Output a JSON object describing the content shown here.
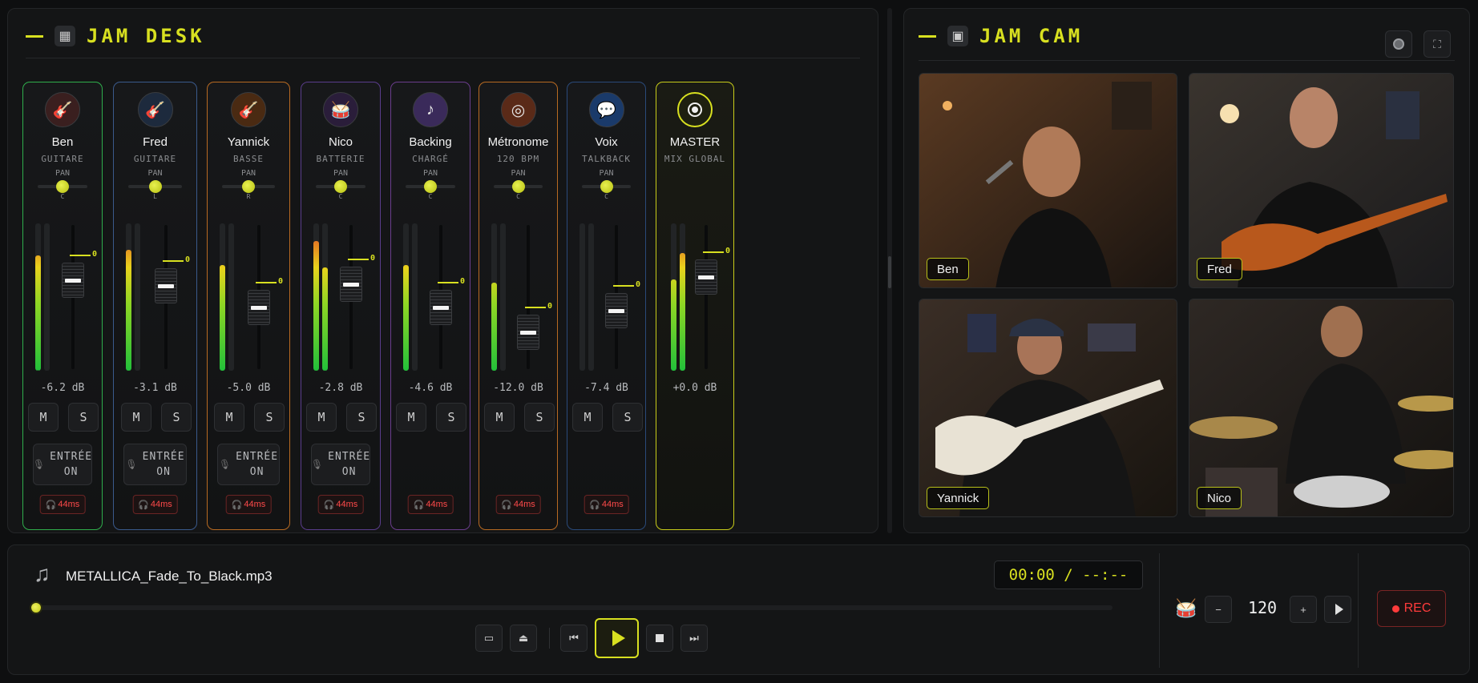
{
  "desk": {
    "title": "JAM DESK",
    "channels": [
      {
        "name": "Ben",
        "role": "GUITARE",
        "pan_label": "PAN",
        "pan_value": "C",
        "pan": 0.5,
        "db": "-6.2 dB",
        "mute": "M",
        "solo": "S",
        "input_line1": "ENTRÉE",
        "input_line2": "ON",
        "latency": "44ms",
        "color": "#2fae4c",
        "icon": "guitar-icon",
        "icon_bg": "#3a1f1f",
        "fader_pos": 0.26,
        "meters": [
          0.78,
          0
        ],
        "zero": "0"
      },
      {
        "name": "Fred",
        "role": "GUITARE",
        "pan_label": "PAN",
        "pan_value": "L",
        "pan": 0.5,
        "db": "-3.1 dB",
        "mute": "M",
        "solo": "S",
        "input_line1": "ENTRÉE",
        "input_line2": "ON",
        "latency": "44ms",
        "color": "#3a5a8c",
        "icon": "guitar-icon",
        "icon_bg": "#1d2a3d",
        "fader_pos": 0.3,
        "meters": [
          0.82,
          0
        ],
        "zero": "0"
      },
      {
        "name": "Yannick",
        "role": "BASSE",
        "pan_label": "PAN",
        "pan_value": "R",
        "pan": 0.5,
        "db": "-5.0 dB",
        "mute": "M",
        "solo": "S",
        "input_line1": "ENTRÉE",
        "input_line2": "ON",
        "latency": "44ms",
        "color": "#b86a22",
        "icon": "bass-guitar-icon",
        "icon_bg": "#4a2a12",
        "fader_pos": 0.45,
        "meters": [
          0.72,
          0
        ],
        "zero": "0"
      },
      {
        "name": "Nico",
        "role": "BATTERIE",
        "pan_label": "PAN",
        "pan_value": "C",
        "pan": 0.5,
        "db": "-2.8 dB",
        "mute": "M",
        "solo": "S",
        "input_line1": "ENTRÉE",
        "input_line2": "ON",
        "latency": "44ms",
        "color": "#5a3d8c",
        "icon": "drum-icon",
        "icon_bg": "#2a1d3a",
        "fader_pos": 0.29,
        "meters": [
          0.88,
          0.7
        ],
        "zero": "0"
      },
      {
        "name": "Backing",
        "role": "CHARGÉ",
        "pan_label": "PAN",
        "pan_value": "C",
        "pan": 0.5,
        "db": "-4.6 dB",
        "mute": "M",
        "solo": "S",
        "input_line1": "",
        "input_line2": "",
        "latency": "44ms",
        "color": "#6a3d8c",
        "icon": "music-note-icon",
        "icon_bg": "#3a2a5a",
        "fader_pos": 0.45,
        "meters": [
          0.72,
          0
        ],
        "zero": "0"
      },
      {
        "name": "Métronome",
        "role": "120 BPM",
        "pan_label": "PAN",
        "pan_value": "C",
        "pan": 0.5,
        "db": "-12.0 dB",
        "mute": "M",
        "solo": "S",
        "input_line1": "",
        "input_line2": "",
        "latency": "44ms",
        "color": "#b86a22",
        "icon": "target-icon",
        "icon_bg": "#5a2a18",
        "fader_pos": 0.62,
        "meters": [
          0.6,
          0
        ],
        "zero": "0"
      },
      {
        "name": "Voix",
        "role": "TALKBACK",
        "pan_label": "PAN",
        "pan_value": "C",
        "pan": 0.5,
        "db": "-7.4 dB",
        "mute": "M",
        "solo": "S",
        "input_line1": "",
        "input_line2": "",
        "latency": "44ms",
        "color": "#2a4a7a",
        "icon": "speech-bubble-icon",
        "icon_bg": "#1a3a6a",
        "fader_pos": 0.47,
        "meters": [
          0,
          0
        ],
        "zero": "0"
      },
      {
        "name": "MASTER",
        "role": "MIX GLOBAL",
        "db": "+0.0 dB",
        "color": "#c8cc1a",
        "icon": "record-circle-icon",
        "fader_pos": 0.24,
        "meters": [
          0.62,
          0.8
        ],
        "zero": "0"
      }
    ]
  },
  "cam": {
    "title": "JAM CAM",
    "tiles": [
      {
        "label": "Ben"
      },
      {
        "label": "Fred"
      },
      {
        "label": "Yannick"
      },
      {
        "label": "Nico"
      }
    ]
  },
  "player": {
    "filename": "METALLICA_Fade_To_Black.mp3",
    "time": "00:00 / --:--",
    "progress": 0.0
  },
  "metronome": {
    "bpm": "120",
    "minus": "−",
    "plus": "+"
  },
  "rec": {
    "label": "REC"
  },
  "colors": {
    "accent": "#d8e020",
    "rec": "#ff3b3b"
  }
}
